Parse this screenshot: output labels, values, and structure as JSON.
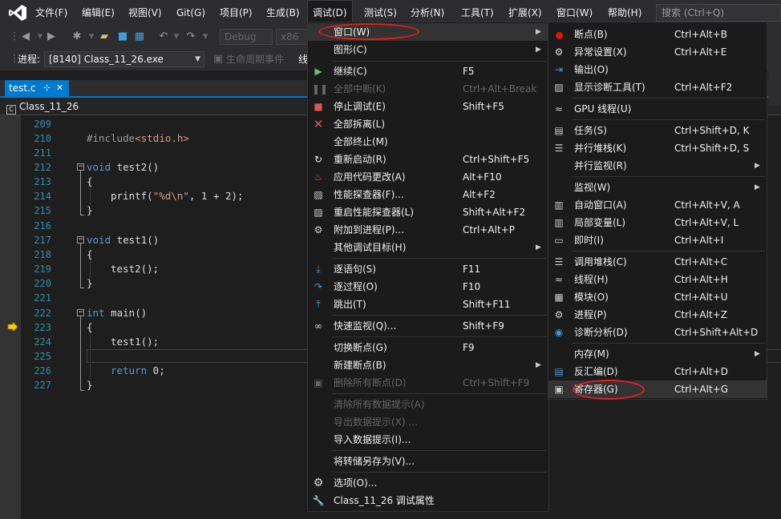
{
  "menubar": {
    "items": [
      "文件(F)",
      "编辑(E)",
      "视图(V)",
      "Git(G)",
      "项目(P)",
      "生成(B)",
      "调试(D)",
      "测试(S)",
      "分析(N)",
      "工具(T)",
      "扩展(X)",
      "窗口(W)",
      "帮助(H)"
    ],
    "search_placeholder": "搜索 (Ctrl+Q)"
  },
  "toolbar": {
    "config": "Debug",
    "platform": "x86",
    "process_label": "进程:",
    "process_value": "[8140] Class_11_26.exe",
    "lifecycle_label": "生命周期事件",
    "thread_label": "线"
  },
  "tab": {
    "name": "test.c",
    "pin": "⊹",
    "close": "✕"
  },
  "nav": {
    "project": "Class_11_26"
  },
  "editor": {
    "lines": [
      "209",
      "210",
      "211",
      "212",
      "213",
      "214",
      "215",
      "216",
      "217",
      "218",
      "219",
      "220",
      "221",
      "222",
      "223",
      "224",
      "225",
      "226",
      "227"
    ],
    "code": {
      "include_kw": "#include",
      "include_file": "<stdio.h>",
      "void1": "void",
      "fn_test2": " test2()",
      "brace_open": "{",
      "brace_close": "}",
      "printf": "printf(",
      "printf_str": "\"%d\\n\"",
      "printf_rest": ", 1 + 2);",
      "void2": "void",
      "fn_test1": " test1()",
      "call_test2": "test2();",
      "int_kw": "int",
      "fn_main": " main()",
      "call_test1": "test1();",
      "return_kw": "return",
      "return_val": " 0;"
    }
  },
  "debug_menu": {
    "items": [
      {
        "label": "窗口(W)",
        "shortcut": "",
        "icon": "",
        "submenu": true
      },
      {
        "label": "图形(C)",
        "shortcut": "",
        "icon": "",
        "submenu": true
      },
      {
        "label": "继续(C)",
        "shortcut": "F5",
        "icon": "play-icon"
      },
      {
        "label": "全部中断(K)",
        "shortcut": "Ctrl+Alt+Break",
        "icon": "pause-icon",
        "disabled": true
      },
      {
        "label": "停止调试(E)",
        "shortcut": "Shift+F5",
        "icon": "stop-icon"
      },
      {
        "label": "全部拆离(L)",
        "shortcut": "",
        "icon": "close-icon"
      },
      {
        "label": "全部终止(M)",
        "shortcut": "",
        "icon": ""
      },
      {
        "label": "重新启动(R)",
        "shortcut": "Ctrl+Shift+F5",
        "icon": "restart-icon"
      },
      {
        "label": "应用代码更改(A)",
        "shortcut": "Alt+F10",
        "icon": "flame-icon"
      },
      {
        "label": "性能探查器(F)...",
        "shortcut": "Alt+F2",
        "icon": "profiler-icon"
      },
      {
        "label": "重启性能探查器(L)",
        "shortcut": "Shift+Alt+F2",
        "icon": "profiler-icon"
      },
      {
        "label": "附加到进程(P)...",
        "shortcut": "Ctrl+Alt+P",
        "icon": "gears-icon"
      },
      {
        "label": "其他调试目标(H)",
        "shortcut": "",
        "icon": "",
        "submenu": true
      },
      {
        "label": "逐语句(S)",
        "shortcut": "F11",
        "icon": "step-into-icon"
      },
      {
        "label": "逐过程(O)",
        "shortcut": "F10",
        "icon": "step-over-icon"
      },
      {
        "label": "跳出(T)",
        "shortcut": "Shift+F11",
        "icon": "step-out-icon"
      },
      {
        "label": "快速监视(Q)...",
        "shortcut": "Shift+F9",
        "icon": "glasses-icon"
      },
      {
        "label": "切换断点(G)",
        "shortcut": "F9",
        "icon": ""
      },
      {
        "label": "新建断点(B)",
        "shortcut": "",
        "icon": "",
        "submenu": true
      },
      {
        "label": "删除所有断点(D)",
        "shortcut": "Ctrl+Shift+F9",
        "icon": "delete-breakpoints-icon",
        "disabled": true
      },
      {
        "label": "清除所有数据提示(A)",
        "shortcut": "",
        "icon": "",
        "disabled": true
      },
      {
        "label": "导出数据提示(X) ...",
        "shortcut": "",
        "icon": "",
        "disabled": true
      },
      {
        "label": "导入数据提示(I)...",
        "shortcut": "",
        "icon": ""
      },
      {
        "label": "将转储另存为(V)...",
        "shortcut": "",
        "icon": ""
      },
      {
        "label": "选项(O)...",
        "shortcut": "",
        "icon": "gear-icon"
      },
      {
        "label": "Class_11_26 调试属性",
        "shortcut": "",
        "icon": "wrench-icon"
      }
    ]
  },
  "window_menu": {
    "items": [
      {
        "label": "断点(B)",
        "shortcut": "Ctrl+Alt+B",
        "icon": "breakpoints-icon"
      },
      {
        "label": "异常设置(X)",
        "shortcut": "Ctrl+Alt+E",
        "icon": "exception-icon"
      },
      {
        "label": "输出(O)",
        "shortcut": "",
        "icon": "output-icon"
      },
      {
        "label": "显示诊断工具(T)",
        "shortcut": "Ctrl+Alt+F2",
        "icon": "diagnostics-icon"
      },
      {
        "label": "GPU 线程(U)",
        "shortcut": "",
        "icon": "gpu-threads-icon"
      },
      {
        "label": "任务(S)",
        "shortcut": "Ctrl+Shift+D, K",
        "icon": "tasks-icon"
      },
      {
        "label": "并行堆栈(K)",
        "shortcut": "Ctrl+Shift+D, S",
        "icon": "parallel-stacks-icon"
      },
      {
        "label": "并行监视(R)",
        "shortcut": "",
        "icon": "",
        "submenu": true
      },
      {
        "label": "监视(W)",
        "shortcut": "",
        "icon": "",
        "submenu": true
      },
      {
        "label": "自动窗口(A)",
        "shortcut": "Ctrl+Alt+V, A",
        "icon": "autos-icon"
      },
      {
        "label": "局部变量(L)",
        "shortcut": "Ctrl+Alt+V, L",
        "icon": "locals-icon"
      },
      {
        "label": "即时(I)",
        "shortcut": "Ctrl+Alt+I",
        "icon": "immediate-icon"
      },
      {
        "label": "调用堆栈(C)",
        "shortcut": "Ctrl+Alt+C",
        "icon": "call-stack-icon"
      },
      {
        "label": "线程(H)",
        "shortcut": "Ctrl+Alt+H",
        "icon": "threads-icon"
      },
      {
        "label": "模块(O)",
        "shortcut": "Ctrl+Alt+U",
        "icon": "modules-icon"
      },
      {
        "label": "进程(P)",
        "shortcut": "Ctrl+Alt+Z",
        "icon": "processes-icon"
      },
      {
        "label": "诊断分析(D)",
        "shortcut": "Ctrl+Shift+Alt+D",
        "icon": "diagnostic-analysis-icon"
      },
      {
        "label": "内存(M)",
        "shortcut": "",
        "icon": "",
        "submenu": true
      },
      {
        "label": "反汇编(D)",
        "shortcut": "Ctrl+Alt+D",
        "icon": "disassembly-icon"
      },
      {
        "label": "寄存器(G)",
        "shortcut": "Ctrl+Alt+G",
        "icon": "registers-icon"
      }
    ]
  }
}
